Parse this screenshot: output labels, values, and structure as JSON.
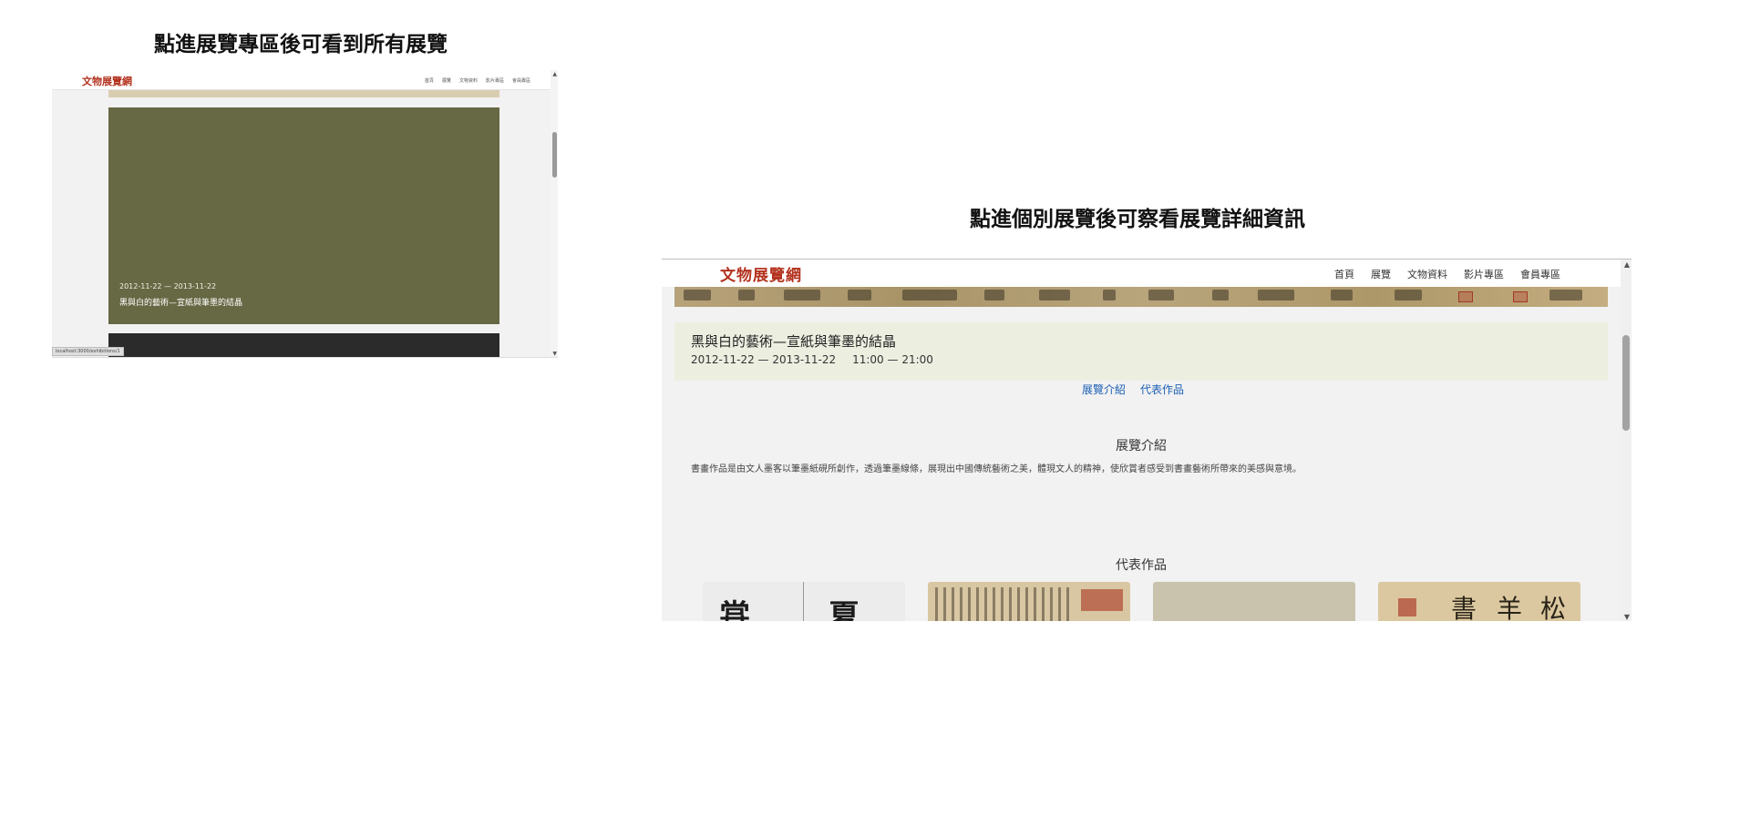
{
  "captions": {
    "left": "點進展覽專區後可看到所有展覽",
    "right": "點進個別展覽後可察看展覽詳細資訊"
  },
  "left_screen": {
    "logo": "文物展覽網",
    "nav": [
      "首頁",
      "展覽",
      "文物資料",
      "影片專區",
      "會員專區"
    ],
    "card": {
      "date_range": "2012-11-22 — 2013-11-22",
      "title": "黑與白的藝術—宣紙與筆墨的結晶",
      "color": "#676844"
    },
    "status_url": "localhost:3000/exhibitions/1"
  },
  "right_screen": {
    "logo": "文物展覽網",
    "nav": [
      "首頁",
      "展覽",
      "文物資料",
      "影片專區",
      "會員專區"
    ],
    "exhibition": {
      "title": "黑與白的藝術—宣紙與筆墨的結晶",
      "date_range": "2012-11-22 — 2013-11-22",
      "hours": "11:00 — 21:00"
    },
    "tabs": [
      "展覽介紹",
      "代表作品"
    ],
    "intro_heading": "展覽介紹",
    "intro_text": "書畫作品是由文人墨客以筆墨紙硯所創作，透過筆墨線條，展現出中國傳統藝術之美，體現文人的精神，使欣賞者感受到書畫藝術所帶來的美感與意境。",
    "works_heading": "代表作品",
    "works": [
      "calligraphy-seal-script",
      "calligraphy-handscroll",
      "landscape-painting",
      "calligraphy-with-seal"
    ],
    "accent_color": "#b3321e",
    "link_color": "#1a5fb4"
  }
}
